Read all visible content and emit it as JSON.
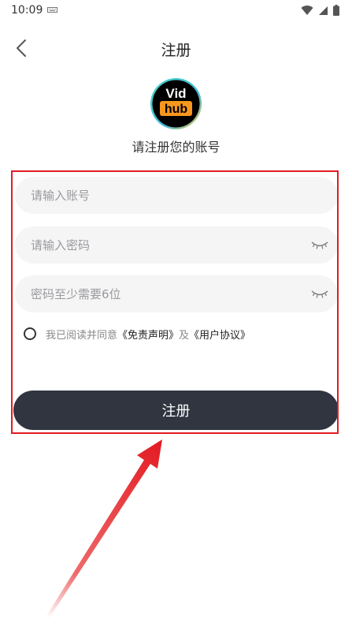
{
  "status_bar": {
    "time": "10:09",
    "icons": [
      "keyboard-icon",
      "wifi-icon",
      "cellular-signal-icon",
      "battery-icon"
    ]
  },
  "header": {
    "back_icon": "chevron-left-icon",
    "title": "注册"
  },
  "logo": {
    "line1": "Vid",
    "line2": "hub",
    "colors": {
      "background": "#000000",
      "ring": "#3fd0c0",
      "accent": "#f7971d"
    }
  },
  "subtitle": "请注册您的账号",
  "form": {
    "account_placeholder": "请输入账号",
    "password_placeholder": "请输入密码",
    "confirm_placeholder": "密码至少需要6位",
    "eye_icon": "eye-closed-icon"
  },
  "agreement": {
    "prefix": "我已阅读并同意",
    "disclaimer_link": "《免责声明》",
    "joiner": "及",
    "user_agreement_link": "《用户协议》"
  },
  "register_button": "注册",
  "annotation": {
    "color": "#e31b23"
  }
}
